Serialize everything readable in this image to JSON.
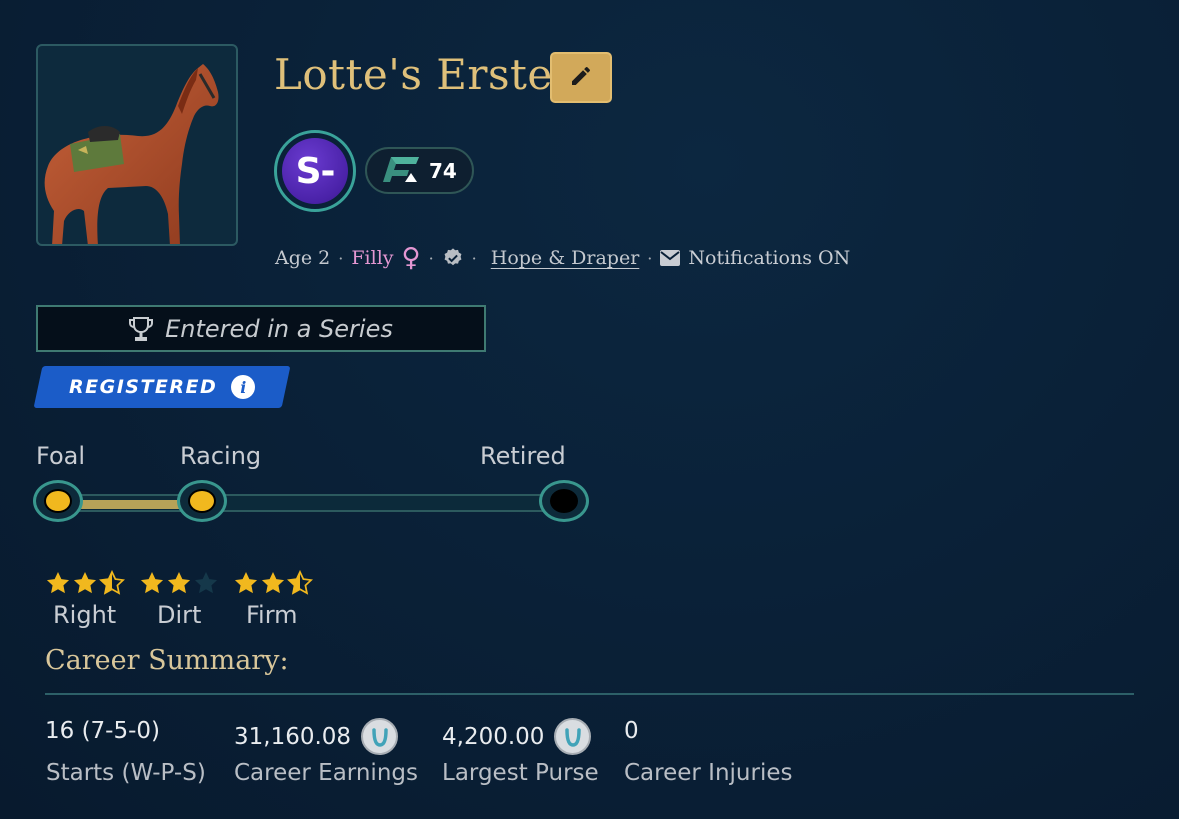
{
  "horse": {
    "name": "Lotte's Erste",
    "image_alt": "chestnut horse with green saddle",
    "grade": "S-",
    "rating": "74",
    "age": "Age 2",
    "sex": "Filly",
    "sex_symbol": "♀",
    "stable": "Hope & Draper",
    "notifications": "Notifications ON"
  },
  "series": {
    "text": "Entered in a Series"
  },
  "registration": {
    "label": "REGISTERED",
    "info_glyph": "i"
  },
  "lifecycle": {
    "stages": [
      "Foal",
      "Racing",
      "Retired"
    ],
    "current_stage": "Racing"
  },
  "preferences": [
    {
      "label": "Right",
      "stars": 2.5,
      "max": 3
    },
    {
      "label": "Dirt",
      "stars": 2,
      "max": 3
    },
    {
      "label": "Firm",
      "stars": 2.5,
      "max": 3
    }
  ],
  "career": {
    "title": "Career Summary:",
    "stats": [
      {
        "value": "16 (7-5-0)",
        "label": "Starts (W-P-S)"
      },
      {
        "value": "31,160.08",
        "label": "Career Earnings"
      },
      {
        "value": "4,200.00",
        "label": "Largest Purse"
      },
      {
        "value": "0",
        "label": "Career Injuries"
      }
    ]
  },
  "icons": {
    "edit": "pencil-icon",
    "verified": "verified-badge-icon",
    "mail": "envelope-icon",
    "trophy": "trophy-icon",
    "info": "info-icon",
    "currency": "horseshoe-coin-icon",
    "rating": "rating-flag-icon"
  },
  "colors": {
    "name_gold": "#dfc07a",
    "edit_button": "#d2a95a",
    "grade_purple": "#4a22a8",
    "filly_pink": "#e497d2",
    "registered_blue": "#1b5cc8",
    "star_gold": "#f1b81e",
    "track_teal": "#39978e"
  }
}
